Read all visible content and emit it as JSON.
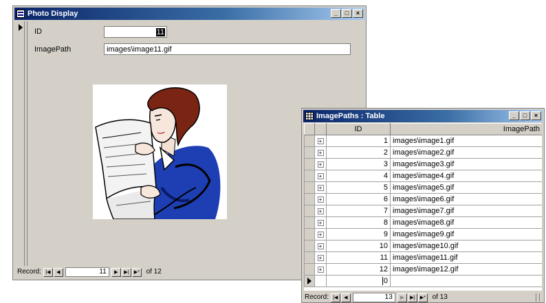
{
  "photo_form": {
    "title": "Photo Display",
    "fields": {
      "id_label": "ID",
      "id_value": "11",
      "imagepath_label": "ImagePath",
      "imagepath_value": "images\\image11.gif"
    },
    "record_nav": {
      "label": "Record:",
      "current": "11",
      "of_text": "of 12"
    }
  },
  "table_window": {
    "title": "ImagePaths : Table",
    "columns": [
      "ID",
      "ImagePath"
    ],
    "rows": [
      {
        "id": "1",
        "path": "images\\image1.gif"
      },
      {
        "id": "2",
        "path": "images\\image2.gif"
      },
      {
        "id": "3",
        "path": "images\\image3.gif"
      },
      {
        "id": "4",
        "path": "images\\image4.gif"
      },
      {
        "id": "5",
        "path": "images\\image5.gif"
      },
      {
        "id": "6",
        "path": "images\\image6.gif"
      },
      {
        "id": "7",
        "path": "images\\image7.gif"
      },
      {
        "id": "8",
        "path": "images\\image8.gif"
      },
      {
        "id": "9",
        "path": "images\\image9.gif"
      },
      {
        "id": "10",
        "path": "images\\image10.gif"
      },
      {
        "id": "11",
        "path": "images\\image11.gif"
      },
      {
        "id": "12",
        "path": "images\\image12.gif"
      }
    ],
    "new_row_value": "0",
    "record_nav": {
      "label": "Record:",
      "current": "13",
      "of_text": "of 13"
    }
  },
  "icons": {
    "form": "form-icon",
    "table": "table-icon",
    "record_selector": "record-pointer-icon"
  }
}
